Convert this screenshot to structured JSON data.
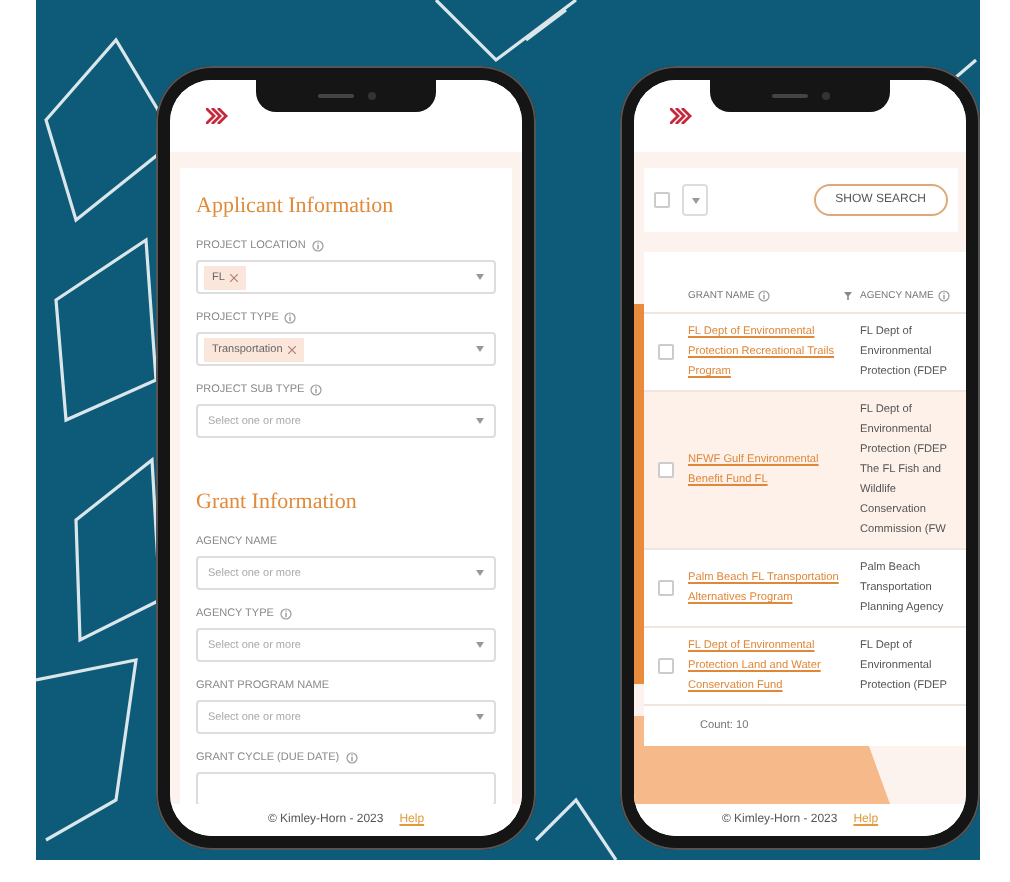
{
  "left_phone": {
    "sections": [
      {
        "title": "Applicant Information",
        "fields": [
          {
            "label": "PROJECT LOCATION",
            "info": true,
            "chips": [
              "FL"
            ]
          },
          {
            "label": "PROJECT TYPE",
            "info": true,
            "chips": [
              "Transportation"
            ]
          },
          {
            "label": "PROJECT SUB TYPE",
            "info": true,
            "placeholder": "Select one or more"
          }
        ]
      },
      {
        "title": "Grant Information",
        "fields": [
          {
            "label": "AGENCY NAME",
            "info": false,
            "placeholder": "Select one or more"
          },
          {
            "label": "AGENCY TYPE",
            "info": true,
            "placeholder": "Select one or more"
          },
          {
            "label": "GRANT PROGRAM NAME",
            "info": false,
            "placeholder": "Select one or more"
          },
          {
            "label": "GRANT CYCLE (DUE DATE)",
            "info": true
          }
        ]
      }
    ],
    "footer": {
      "copyright": "© Kimley-Horn - 2023",
      "link": "Help"
    }
  },
  "right_phone": {
    "toolbar": {
      "select_all_checked": false,
      "button": "SHOW SEARCH"
    },
    "table": {
      "columns": [
        {
          "label": "GRANT NAME",
          "info": true,
          "filter": true
        },
        {
          "label": "AGENCY NAME",
          "info": true,
          "filter": false
        }
      ],
      "rows": [
        {
          "checked": false,
          "highlighted": false,
          "grant": "FL Dept of Environmental Protection Recreational Trails Program",
          "agency": "FL Dept of Environmental Protection (FDEP"
        },
        {
          "checked": false,
          "highlighted": true,
          "grant": "NFWF Gulf Environmental Benefit Fund FL",
          "agency": "FL Dept of Environmental Protection (FDEP The FL Fish and Wildlife Conservation Commission (FW"
        },
        {
          "checked": false,
          "highlighted": false,
          "grant": "Palm Beach FL Transportation Alternatives Program",
          "agency": "Palm Beach Transportation Planning Agency"
        },
        {
          "checked": false,
          "highlighted": false,
          "grant": "FL Dept of Environmental Protection Land and Water Conservation Fund",
          "agency": "FL Dept of Environmental Protection (FDEP"
        }
      ],
      "count": "Count: 10"
    },
    "footer": {
      "copyright": "© Kimley-Horn - 2023",
      "link": "Help"
    }
  }
}
